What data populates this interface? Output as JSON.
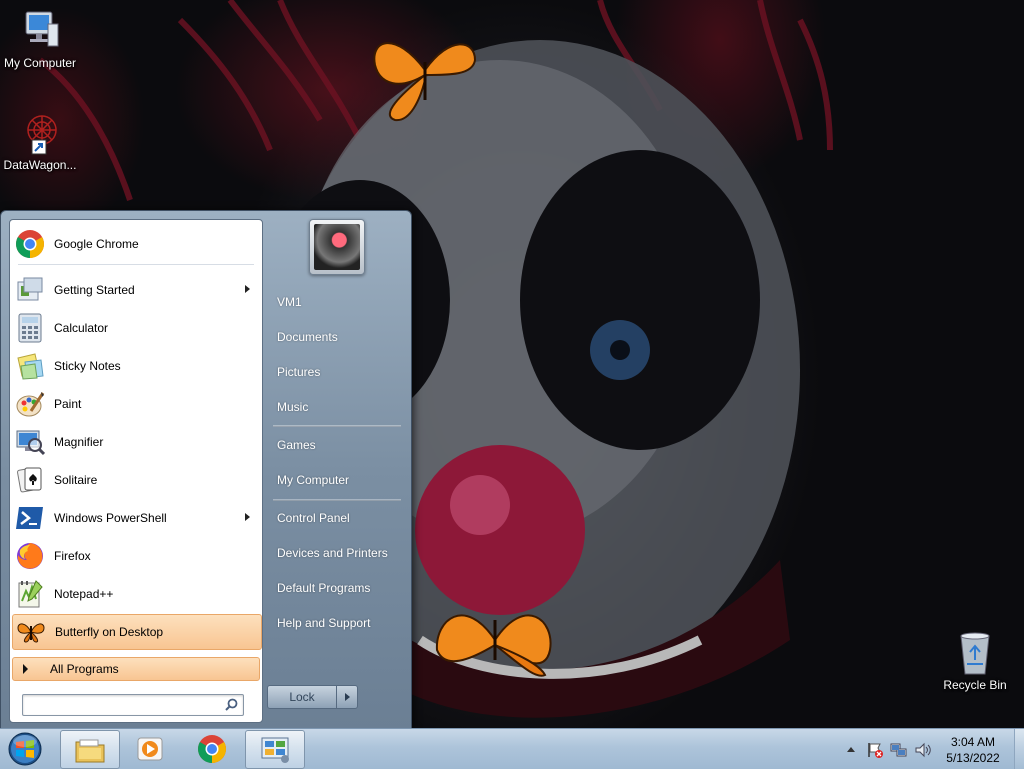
{
  "desktop": {
    "icons": [
      {
        "label": "My Computer"
      },
      {
        "label": "DataWagon..."
      },
      {
        "label": "Recycle Bin"
      }
    ]
  },
  "start_menu": {
    "programs": [
      {
        "label": "Google Chrome",
        "icon": "chrome-icon",
        "submenu": false
      },
      {
        "label": "Getting Started",
        "icon": "getting-started-icon",
        "submenu": true
      },
      {
        "label": "Calculator",
        "icon": "calculator-icon",
        "submenu": false
      },
      {
        "label": "Sticky Notes",
        "icon": "sticky-notes-icon",
        "submenu": false
      },
      {
        "label": "Paint",
        "icon": "paint-icon",
        "submenu": false
      },
      {
        "label": "Magnifier",
        "icon": "magnifier-icon",
        "submenu": false
      },
      {
        "label": "Solitaire",
        "icon": "solitaire-icon",
        "submenu": false
      },
      {
        "label": "Windows PowerShell",
        "icon": "powershell-icon",
        "submenu": true
      },
      {
        "label": "Firefox",
        "icon": "firefox-icon",
        "submenu": false
      },
      {
        "label": "Notepad++",
        "icon": "notepadpp-icon",
        "submenu": false
      },
      {
        "label": "Butterfly on Desktop",
        "icon": "butterfly-icon",
        "submenu": false,
        "highlighted": true
      }
    ],
    "all_programs": "All Programs",
    "search": {
      "value": "",
      "placeholder": ""
    },
    "right_links": [
      {
        "label": "VM1"
      },
      {
        "label": "Documents"
      },
      {
        "label": "Pictures"
      },
      {
        "label": "Music"
      },
      {
        "label": "Games"
      },
      {
        "label": "My Computer"
      },
      {
        "label": "Control Panel"
      },
      {
        "label": "Devices and Printers"
      },
      {
        "label": "Default Programs"
      },
      {
        "label": "Help and Support"
      }
    ],
    "lock_label": "Lock"
  },
  "taskbar": {
    "pinned": [
      "explorer-icon",
      "media-player-icon",
      "chrome-icon",
      "control-panel-icon"
    ],
    "clock": {
      "time": "3:04 AM",
      "date": "5/13/2022"
    }
  },
  "colors": {
    "highlight": "#f8c592",
    "taskbar": "#adc4da",
    "menu_right": "#7b8fa3"
  }
}
